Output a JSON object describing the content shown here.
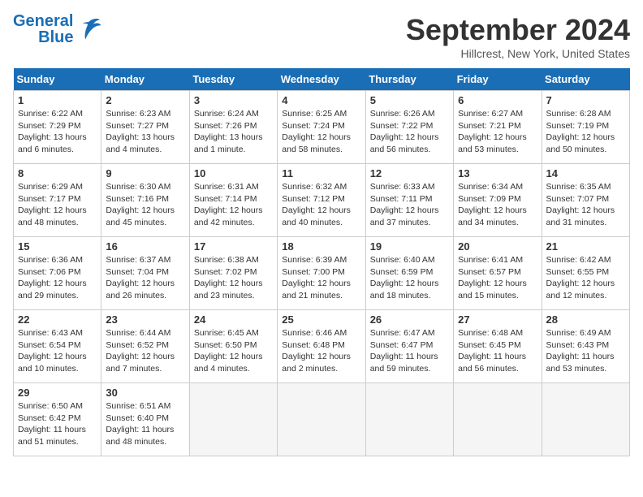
{
  "header": {
    "logo_line1": "General",
    "logo_line2": "Blue",
    "month": "September 2024",
    "location": "Hillcrest, New York, United States"
  },
  "days_of_week": [
    "Sunday",
    "Monday",
    "Tuesday",
    "Wednesday",
    "Thursday",
    "Friday",
    "Saturday"
  ],
  "weeks": [
    [
      {
        "day": "1",
        "sunrise": "6:22 AM",
        "sunset": "7:29 PM",
        "daylight": "13 hours and 6 minutes."
      },
      {
        "day": "2",
        "sunrise": "6:23 AM",
        "sunset": "7:27 PM",
        "daylight": "13 hours and 4 minutes."
      },
      {
        "day": "3",
        "sunrise": "6:24 AM",
        "sunset": "7:26 PM",
        "daylight": "13 hours and 1 minute."
      },
      {
        "day": "4",
        "sunrise": "6:25 AM",
        "sunset": "7:24 PM",
        "daylight": "12 hours and 58 minutes."
      },
      {
        "day": "5",
        "sunrise": "6:26 AM",
        "sunset": "7:22 PM",
        "daylight": "12 hours and 56 minutes."
      },
      {
        "day": "6",
        "sunrise": "6:27 AM",
        "sunset": "7:21 PM",
        "daylight": "12 hours and 53 minutes."
      },
      {
        "day": "7",
        "sunrise": "6:28 AM",
        "sunset": "7:19 PM",
        "daylight": "12 hours and 50 minutes."
      }
    ],
    [
      {
        "day": "8",
        "sunrise": "6:29 AM",
        "sunset": "7:17 PM",
        "daylight": "12 hours and 48 minutes."
      },
      {
        "day": "9",
        "sunrise": "6:30 AM",
        "sunset": "7:16 PM",
        "daylight": "12 hours and 45 minutes."
      },
      {
        "day": "10",
        "sunrise": "6:31 AM",
        "sunset": "7:14 PM",
        "daylight": "12 hours and 42 minutes."
      },
      {
        "day": "11",
        "sunrise": "6:32 AM",
        "sunset": "7:12 PM",
        "daylight": "12 hours and 40 minutes."
      },
      {
        "day": "12",
        "sunrise": "6:33 AM",
        "sunset": "7:11 PM",
        "daylight": "12 hours and 37 minutes."
      },
      {
        "day": "13",
        "sunrise": "6:34 AM",
        "sunset": "7:09 PM",
        "daylight": "12 hours and 34 minutes."
      },
      {
        "day": "14",
        "sunrise": "6:35 AM",
        "sunset": "7:07 PM",
        "daylight": "12 hours and 31 minutes."
      }
    ],
    [
      {
        "day": "15",
        "sunrise": "6:36 AM",
        "sunset": "7:06 PM",
        "daylight": "12 hours and 29 minutes."
      },
      {
        "day": "16",
        "sunrise": "6:37 AM",
        "sunset": "7:04 PM",
        "daylight": "12 hours and 26 minutes."
      },
      {
        "day": "17",
        "sunrise": "6:38 AM",
        "sunset": "7:02 PM",
        "daylight": "12 hours and 23 minutes."
      },
      {
        "day": "18",
        "sunrise": "6:39 AM",
        "sunset": "7:00 PM",
        "daylight": "12 hours and 21 minutes."
      },
      {
        "day": "19",
        "sunrise": "6:40 AM",
        "sunset": "6:59 PM",
        "daylight": "12 hours and 18 minutes."
      },
      {
        "day": "20",
        "sunrise": "6:41 AM",
        "sunset": "6:57 PM",
        "daylight": "12 hours and 15 minutes."
      },
      {
        "day": "21",
        "sunrise": "6:42 AM",
        "sunset": "6:55 PM",
        "daylight": "12 hours and 12 minutes."
      }
    ],
    [
      {
        "day": "22",
        "sunrise": "6:43 AM",
        "sunset": "6:54 PM",
        "daylight": "12 hours and 10 minutes."
      },
      {
        "day": "23",
        "sunrise": "6:44 AM",
        "sunset": "6:52 PM",
        "daylight": "12 hours and 7 minutes."
      },
      {
        "day": "24",
        "sunrise": "6:45 AM",
        "sunset": "6:50 PM",
        "daylight": "12 hours and 4 minutes."
      },
      {
        "day": "25",
        "sunrise": "6:46 AM",
        "sunset": "6:48 PM",
        "daylight": "12 hours and 2 minutes."
      },
      {
        "day": "26",
        "sunrise": "6:47 AM",
        "sunset": "6:47 PM",
        "daylight": "11 hours and 59 minutes."
      },
      {
        "day": "27",
        "sunrise": "6:48 AM",
        "sunset": "6:45 PM",
        "daylight": "11 hours and 56 minutes."
      },
      {
        "day": "28",
        "sunrise": "6:49 AM",
        "sunset": "6:43 PM",
        "daylight": "11 hours and 53 minutes."
      }
    ],
    [
      {
        "day": "29",
        "sunrise": "6:50 AM",
        "sunset": "6:42 PM",
        "daylight": "11 hours and 51 minutes."
      },
      {
        "day": "30",
        "sunrise": "6:51 AM",
        "sunset": "6:40 PM",
        "daylight": "11 hours and 48 minutes."
      },
      null,
      null,
      null,
      null,
      null
    ]
  ]
}
